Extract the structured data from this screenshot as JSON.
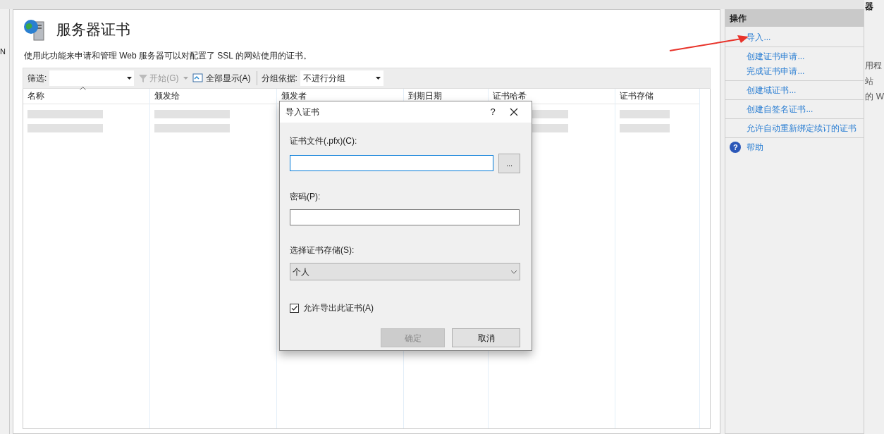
{
  "left_strip": {
    "text": "N"
  },
  "page": {
    "title": "服务器证书",
    "description": "使用此功能来申请和管理 Web 服务器可以对配置了 SSL 的网站使用的证书。"
  },
  "toolbar": {
    "filter_label": "筛选:",
    "start_button": {
      "label": "开始(G)",
      "disabled": true
    },
    "show_all_button": "全部显示(A)",
    "group_label": "分组依据:",
    "group_value": "不进行分组"
  },
  "table": {
    "columns": [
      {
        "label": "名称",
        "sorted": true
      },
      {
        "label": "颁发给",
        "sorted": false
      },
      {
        "label": "颁发者",
        "sorted": false
      },
      {
        "label": "到期日期",
        "sorted": false
      },
      {
        "label": "证书哈希",
        "sorted": false
      },
      {
        "label": "证书存储",
        "sorted": false
      }
    ]
  },
  "actions": {
    "title": "操作",
    "items": [
      {
        "label": "导入...",
        "kind": "link",
        "group_end": true
      },
      {
        "label": "创建证书申请...",
        "kind": "link",
        "group_end": false
      },
      {
        "label": "完成证书申请...",
        "kind": "link",
        "group_end": true
      },
      {
        "label": "创建域证书...",
        "kind": "link",
        "group_end": true
      },
      {
        "label": "创建自签名证书...",
        "kind": "link",
        "group_end": true
      },
      {
        "label": "允许自动重新绑定续订的证书",
        "kind": "link",
        "group_end": true
      },
      {
        "label": "帮助",
        "kind": "help",
        "icon_glyph": "?",
        "group_end": false
      }
    ]
  },
  "background_window": [
    "器",
    "用程",
    "站",
    "的 W"
  ],
  "dialog": {
    "title": "导入证书",
    "help": "?",
    "file_label": "证书文件(.pfx)(C):",
    "browse": "...",
    "password_label": "密码(P):",
    "store_label": "选择证书存储(S):",
    "store_value": "个人",
    "export_checkbox": {
      "label": "允许导出此证书(A)",
      "checked": true
    },
    "ok": {
      "label": "确定",
      "disabled": true
    },
    "cancel": {
      "label": "取消",
      "disabled": false
    }
  }
}
